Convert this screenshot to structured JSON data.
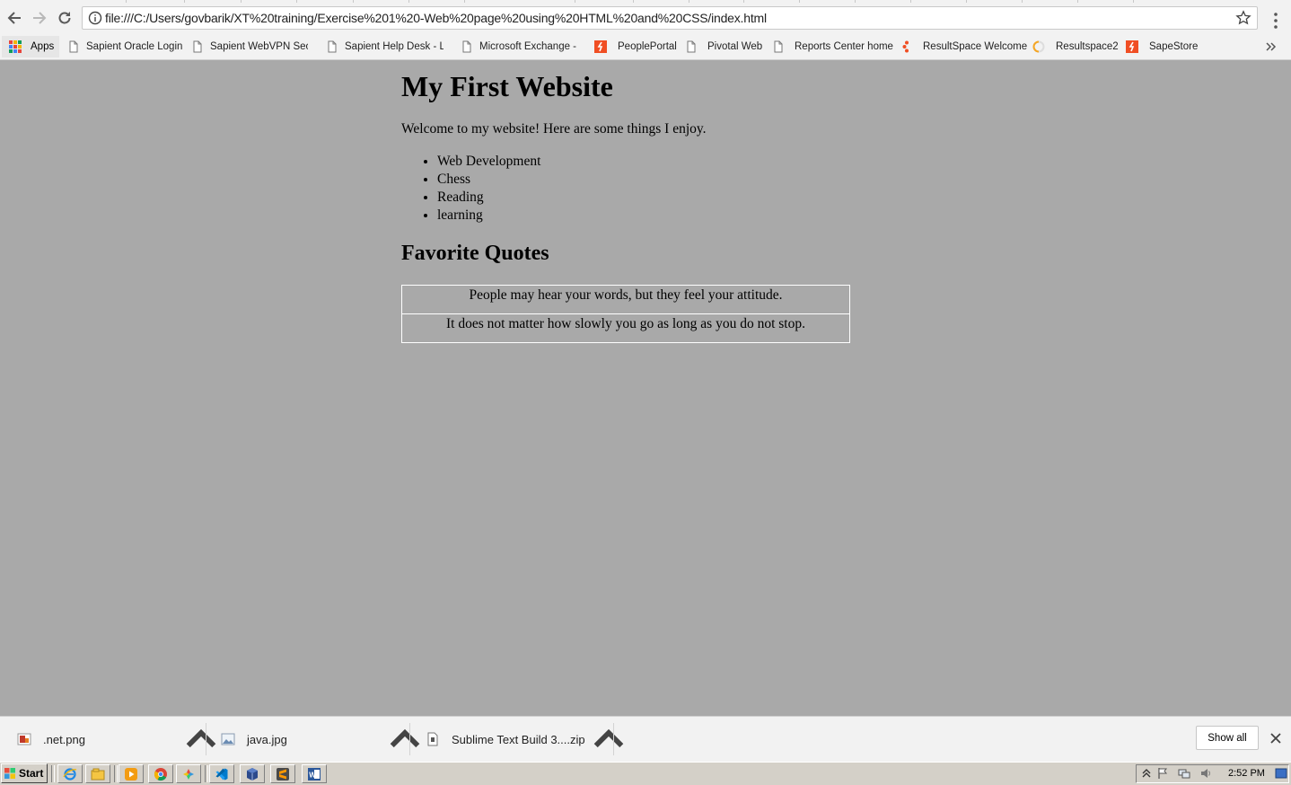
{
  "browser": {
    "address_url": "file:///C:/Users/govbarik/XT%20training/Exercise%201%20-Web%20page%20using%20HTML%20and%20CSS/index.html",
    "bookmarks_bar": {
      "apps_label": "Apps",
      "items": [
        {
          "label": "Sapient Oracle Login",
          "icon": "page-icon"
        },
        {
          "label": "Sapient WebVPN Secur",
          "icon": "page-icon"
        },
        {
          "label": "Sapient Help Desk - Lo",
          "icon": "page-icon"
        },
        {
          "label": "Microsoft Exchange - C",
          "icon": "page-icon"
        },
        {
          "label": "PeoplePortal",
          "icon": "sapient-icon"
        },
        {
          "label": "Pivotal Web",
          "icon": "page-icon"
        },
        {
          "label": "Reports Center home",
          "icon": "page-icon"
        },
        {
          "label": "ResultSpace  Welcome",
          "icon": "sapient-dots-icon"
        },
        {
          "label": "Resultspace2",
          "icon": "loading-icon"
        },
        {
          "label": "SapeStore",
          "icon": "sapient-icon"
        }
      ]
    }
  },
  "page": {
    "heading": "My First Website",
    "intro": "Welcome to my website! Here are some things I enjoy.",
    "hobbies": [
      "Web Development",
      "Chess",
      "Reading",
      "learning"
    ],
    "quotes_heading": "Favorite Quotes",
    "quotes": [
      "People may hear your words, but they feel your attitude.",
      "It does not matter how slowly you go as long as you do not stop."
    ]
  },
  "downloads": {
    "items": [
      {
        "name": ".net.png",
        "icon": "image-file-icon"
      },
      {
        "name": "java.jpg",
        "icon": "image-file-icon"
      },
      {
        "name": "Sublime Text Build 3....zip",
        "icon": "zip-file-icon"
      }
    ],
    "show_all_label": "Show all"
  },
  "taskbar": {
    "start_label": "Start",
    "apps": [
      "internet-explorer-icon",
      "file-explorer-icon",
      "media-player-icon",
      "chrome-icon",
      "photos-icon",
      "visual-studio-code-icon",
      "virtualbox-icon",
      "sublime-text-icon",
      "word-icon"
    ],
    "clock": "2:52 PM"
  },
  "colors": {
    "page_background": "#a9a9a9",
    "chrome_background": "#f2f2f2",
    "taskbar_background": "#d4d0c8",
    "sapient_orange": "#f04e23"
  }
}
